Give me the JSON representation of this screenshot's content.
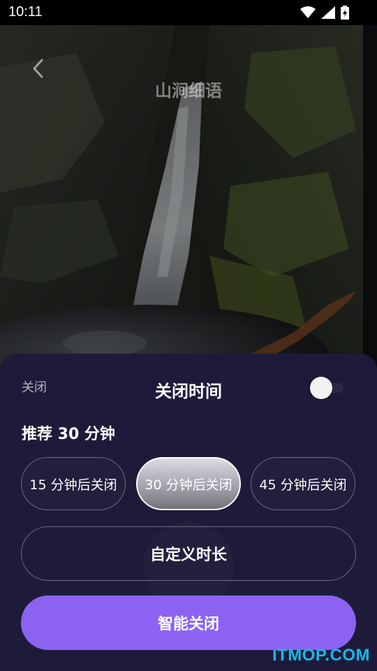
{
  "status_bar": {
    "time": "10:11",
    "icons": [
      "wifi-icon",
      "signal-icon",
      "battery-icon"
    ]
  },
  "header": {
    "title": "山涧细语",
    "back_icon": "chevron-left-icon"
  },
  "sheet": {
    "close_label": "关闭",
    "title": "关闭时间",
    "toggle_on": false,
    "recommend": "推荐 30 分钟",
    "options": [
      {
        "label": "15 分钟后关闭",
        "selected": false
      },
      {
        "label": "30 分钟后关闭",
        "selected": true
      },
      {
        "label": "45 分钟后关闭",
        "selected": false
      }
    ],
    "custom_label": "自定义时长",
    "smart_label": "智能关闭"
  },
  "colors": {
    "sheet_bg": "#1e1b3a",
    "accent": "#8b63f0",
    "watermark": "#19b8e8"
  },
  "watermark": "ITMOP.COM"
}
